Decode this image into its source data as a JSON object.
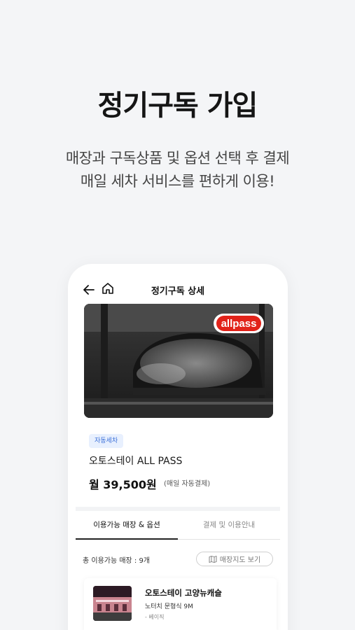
{
  "headline": "정기구독 가입",
  "subline1": "매장과 구독상품 및 옵션 선택 후 결제",
  "subline2": "매일 세차 서비스를 편하게 이용!",
  "screen": {
    "title": "정기구독 상세",
    "hero": {
      "logo_text": "allpass"
    },
    "badge": "자동세차",
    "product_name": "오토스테이 ALL PASS",
    "price": "월 39,500원",
    "price_note": "(매일 자동결제)",
    "tabs": [
      {
        "label": "이용가능 매장 & 옵션",
        "active": true
      },
      {
        "label": "결제 및 이용안내",
        "active": false
      }
    ],
    "store_count": "총 이용가능 매장 : 9개",
    "map_button": "매장지도 보기",
    "store": {
      "name": "오토스테이 고양뉴캐슬",
      "address": "노터치 문형식 9M",
      "option": "- 베이직"
    }
  },
  "colors": {
    "background": "#f4f5f7",
    "badge_bg": "#e8f0fe",
    "badge_text": "#3a6fd8",
    "logo_red": "#e2231a"
  },
  "icons": [
    "back-arrow-icon",
    "home-icon",
    "map-icon"
  ]
}
